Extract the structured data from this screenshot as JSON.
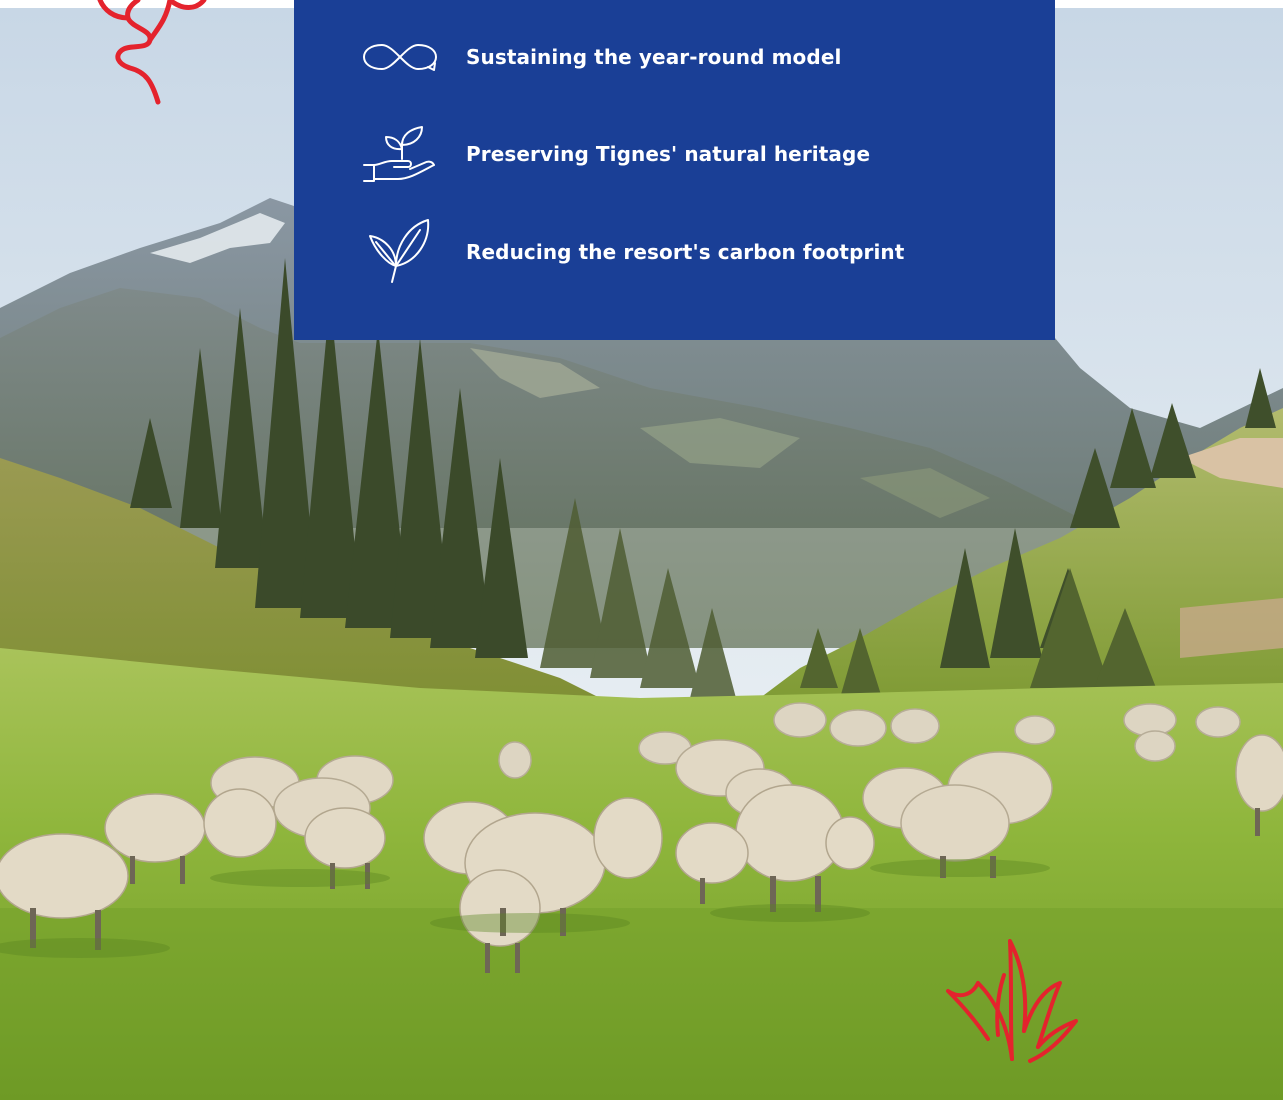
{
  "panel": {
    "background_color": "#1a3f96",
    "items": [
      {
        "icon": "infinity-cycle-icon",
        "label": "Sustaining the year-round model"
      },
      {
        "icon": "hand-sprout-icon",
        "label": "Preserving Tignes' natural heritage"
      },
      {
        "icon": "leaf-icon",
        "label": "Reducing the resort's carbon footprint"
      }
    ]
  },
  "scene": {
    "photo": "alpine-meadow-with-grazing-sheep"
  },
  "decorations": {
    "accent_color": "#e4232d",
    "top_doodle": "red-flower-doodle",
    "bottom_doodle": "red-grass-tuft-doodle"
  }
}
